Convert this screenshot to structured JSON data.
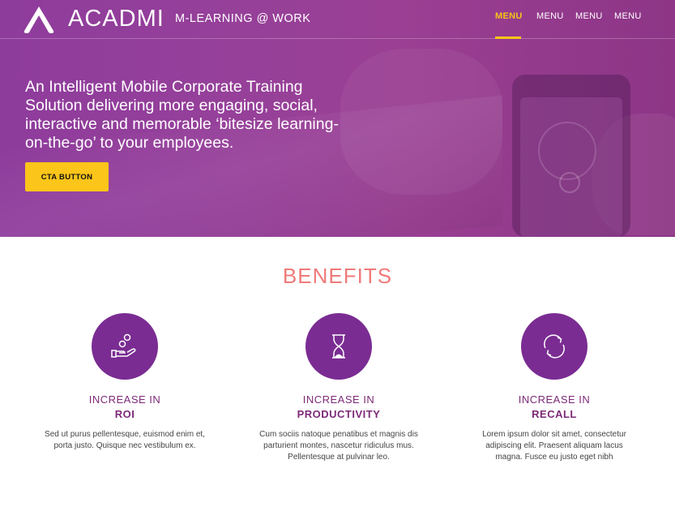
{
  "header": {
    "logo_text": "ACADMI",
    "tagline": "M-LEARNING @ WORK",
    "nav": [
      "MENU",
      "MENU",
      "MENU",
      "MENU"
    ],
    "active_index": 0,
    "accent_color": "#f5c518"
  },
  "hero": {
    "headline": "An Intelligent Mobile Corporate Training Solution delivering more engaging, social, interactive and memorable ‘bitesize learning-on-the-go’ to your employees.",
    "cta_label": "CTA BUTTON",
    "cta_color": "#fcc51a"
  },
  "benefits": {
    "title": "BENEFITS",
    "items": [
      {
        "icon": "hand-coins-icon",
        "line1": "INCREASE IN",
        "line2": "ROI",
        "text": "Sed ut purus pellentesque, euismod enim et, porta justo. Quisque nec vestibulum ex."
      },
      {
        "icon": "hourglass-icon",
        "line1": "INCREASE IN",
        "line2": "PRODUCTIVITY",
        "text": "Cum sociis natoque penatibus et magnis dis parturient montes, nascetur ridiculus mus. Pellentesque at pulvinar leo."
      },
      {
        "icon": "refresh-cycle-icon",
        "line1": "INCREASE IN",
        "line2": "RECALL",
        "text": "Lorem ipsum dolor sit amet, consectetur adipiscing elit. Praesent aliquam lacus magna. Fusce eu justo eget nibh"
      }
    ]
  }
}
